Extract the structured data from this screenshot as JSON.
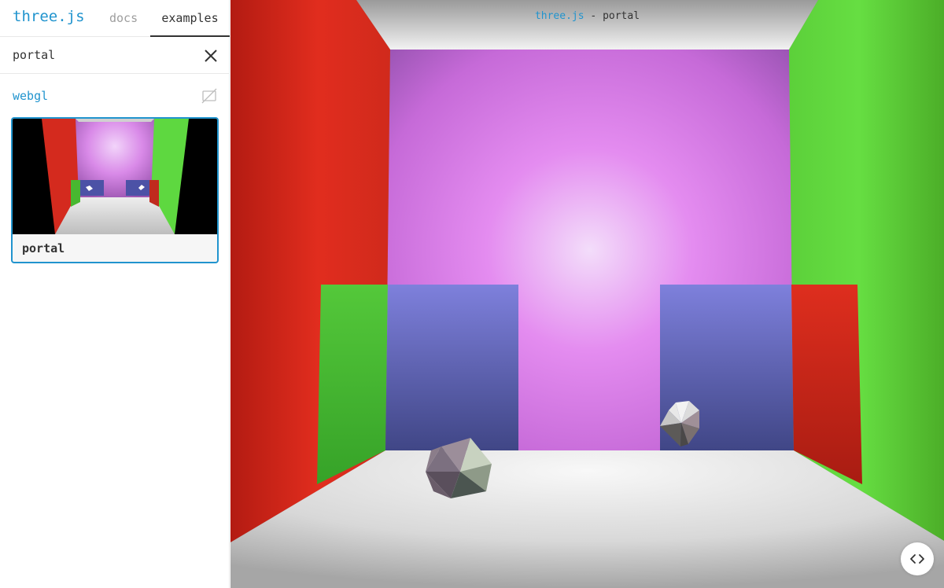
{
  "header": {
    "logo": "three.js",
    "tabs": [
      {
        "label": "docs",
        "active": false
      },
      {
        "label": "examples",
        "active": true
      }
    ]
  },
  "search": {
    "value": "portal",
    "placeholder": "",
    "clear_icon": "close-icon"
  },
  "sidebar": {
    "category": "webgl",
    "category_icon": "no-preview-icon",
    "examples": [
      {
        "title": "portal",
        "selected": true
      }
    ]
  },
  "viewport": {
    "info_link": "three.js",
    "info_separator": " - ",
    "info_title": "portal",
    "code_button_icon": "code-icon"
  },
  "colors": {
    "accent": "#2194ce",
    "text": "#333333",
    "muted": "#9e9e9e",
    "wall_red": "#e02a1c",
    "wall_green": "#5fe040",
    "wall_back": "#d87ae8",
    "portal_blue": "#5a5cac"
  }
}
